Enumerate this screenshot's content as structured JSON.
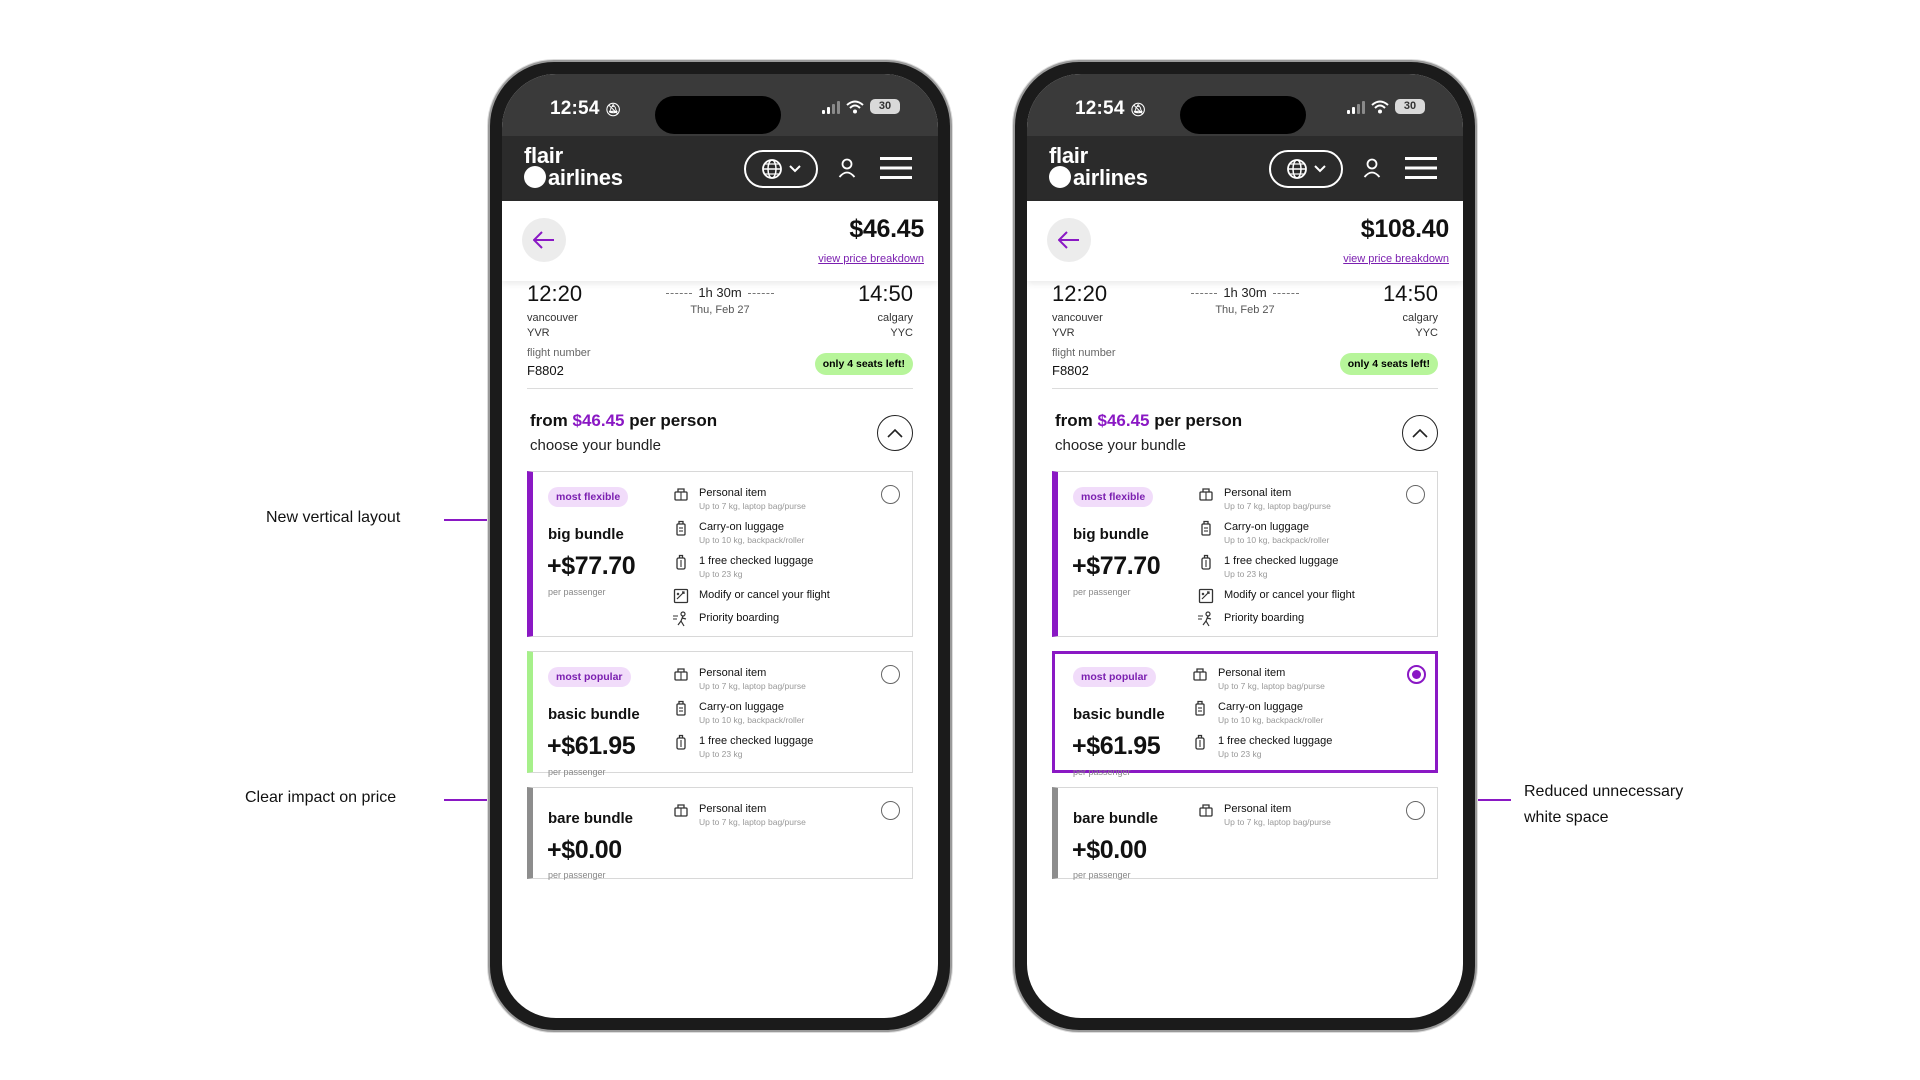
{
  "status": {
    "time": "12:54",
    "battery": "30"
  },
  "brand": {
    "line1": "flair",
    "line2": "airlines"
  },
  "phones": [
    {
      "total_price": "$46.45",
      "bundles_selected": "none"
    },
    {
      "total_price": "$108.40",
      "bundles_selected": "basic bundle"
    }
  ],
  "price_breakdown_link": "view price breakdown",
  "flight": {
    "dep_time": "12:20",
    "arr_time": "14:50",
    "duration": "1h 30m",
    "date": "Thu, Feb 27",
    "dep_city": "vancouver",
    "dep_code": "YVR",
    "arr_city": "calgary",
    "arr_code": "YYC",
    "flight_number_label": "flight number",
    "flight_number": "F8802",
    "seats_badge": "only 4 seats left!"
  },
  "bundle_header": {
    "from_prefix": "from",
    "from_price": "$46.45",
    "from_suffix": "per person",
    "subtitle": "choose your bundle"
  },
  "bundles": {
    "flexible": {
      "tag": "most flexible",
      "name": "big bundle",
      "price": "+$77.70",
      "per": "per passenger",
      "features": [
        {
          "icon": "bag-icon",
          "title": "Personal item",
          "sub": "Up to 7 kg, laptop bag/purse"
        },
        {
          "icon": "luggage-icon",
          "title": "Carry-on luggage",
          "sub": "Up to 10 kg, backpack/roller"
        },
        {
          "icon": "suitcase-icon",
          "title": "1 free checked luggage",
          "sub": "Up to 23 kg"
        },
        {
          "icon": "modify-icon",
          "title": "Modify or cancel your flight",
          "sub": ""
        },
        {
          "icon": "priority-icon",
          "title": "Priority boarding",
          "sub": ""
        }
      ]
    },
    "popular": {
      "tag": "most popular",
      "name": "basic bundle",
      "price": "+$61.95",
      "per": "per passenger",
      "features": [
        {
          "icon": "bag-icon",
          "title": "Personal item",
          "sub": "Up to 7 kg, laptop bag/purse"
        },
        {
          "icon": "luggage-icon",
          "title": "Carry-on luggage",
          "sub": "Up to 10 kg, backpack/roller"
        },
        {
          "icon": "suitcase-icon",
          "title": "1 free checked luggage",
          "sub": "Up to 23 kg"
        }
      ]
    },
    "bare": {
      "name": "bare bundle",
      "price": "+$0.00",
      "per": "per passenger",
      "features": [
        {
          "icon": "bag-icon",
          "title": "Personal item",
          "sub": "Up to 7 kg, laptop bag/purse"
        }
      ]
    }
  },
  "annotations": {
    "vertical": "New vertical layout",
    "price": "Clear impact on price",
    "whitespace_1": "Reduced unnecessary",
    "whitespace_2": "white space"
  },
  "colors": {
    "accent": "#8a18c4",
    "popular": "#a6f08a",
    "bare": "#8d8d8d",
    "seats": "#b7f59a",
    "nav": "#2b2b2b"
  }
}
